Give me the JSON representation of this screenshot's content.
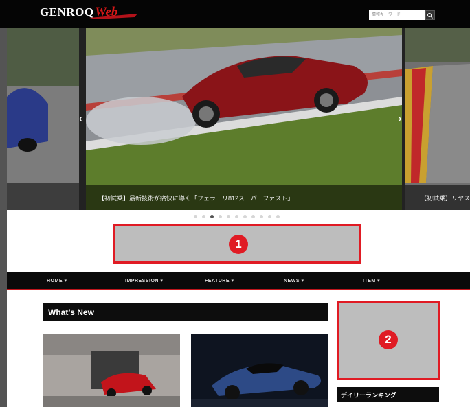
{
  "header": {
    "logo_main": "GENROQ",
    "logo_script": "Web",
    "search_placeholder": "情報キーワード",
    "search_button_icon": "search-icon"
  },
  "hero": {
    "main_caption": "【初試乗】最新技術が痛快に導く「フェラーリ812スーパーファスト」",
    "right_caption": "【初試乗】リヤス",
    "prev_arrow": "‹",
    "next_arrow": "›",
    "dot_count": 11,
    "active_dot": 3
  },
  "placeholders": {
    "badge1": "1",
    "badge2": "2"
  },
  "nav": {
    "items": [
      {
        "label": "HOME ▾"
      },
      {
        "label": "IMPRESSION ▾"
      },
      {
        "label": "FEATURE ▾"
      },
      {
        "label": "NEWS ▾"
      },
      {
        "label": "ITEM ▾"
      }
    ]
  },
  "whats_new": {
    "title": "What’s New"
  },
  "sidebar": {
    "ranking_title": "デイリーランキング"
  },
  "colors": {
    "accent_red": "#e01b24",
    "header_bg": "#050505",
    "placeholder_gray": "#bdbdbd"
  }
}
